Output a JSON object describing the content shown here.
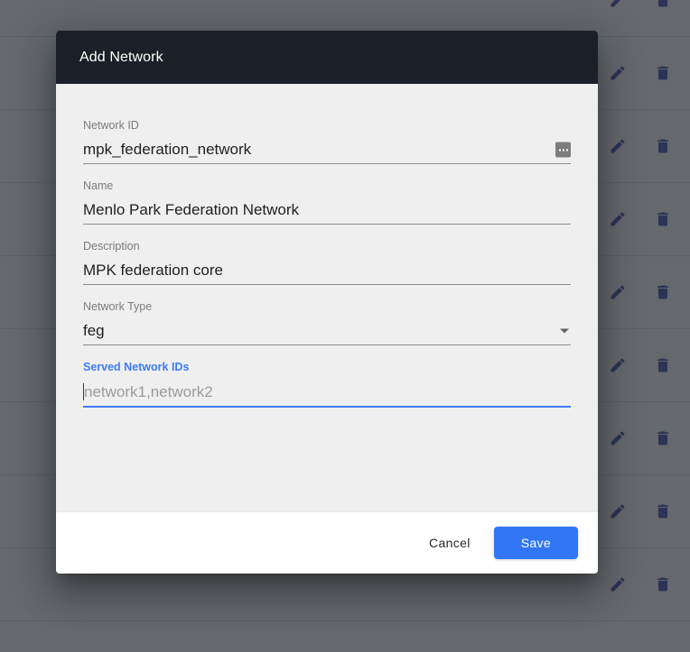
{
  "background": {
    "name": "networks-table",
    "row_count": 9,
    "row_action_icons": [
      "edit-icon",
      "delete-icon"
    ],
    "icon_color": "#3f51b5",
    "divider_color": "#e2e4e8"
  },
  "scrim": {
    "name": "modal-backdrop",
    "color": "rgba(36,40,47,0.70)"
  },
  "dialog": {
    "title": "Add Network",
    "title_bar_color": "#1b1f27",
    "body_color": "#efefef",
    "accent_color": "#3276f5",
    "fields": [
      {
        "id": "network-id",
        "label": "Network ID",
        "value": "mpk_federation_network",
        "placeholder": "",
        "focused": false,
        "adornment": "more-horizontal-icon"
      },
      {
        "id": "name",
        "label": "Name",
        "value": "Menlo Park Federation Network",
        "placeholder": "",
        "focused": false,
        "adornment": ""
      },
      {
        "id": "description",
        "label": "Description",
        "value": "MPK federation core",
        "placeholder": "",
        "focused": false,
        "adornment": ""
      },
      {
        "id": "network-type",
        "label": "Network Type",
        "value": "feg",
        "placeholder": "",
        "focused": false,
        "adornment": "chevron-down-icon",
        "options": [
          "feg"
        ]
      },
      {
        "id": "served-network-ids",
        "label": "Served Network IDs",
        "value": "",
        "placeholder": "network1,network2",
        "focused": true,
        "adornment": ""
      }
    ],
    "actions": {
      "cancel_label": "Cancel",
      "save_label": "Save"
    }
  }
}
